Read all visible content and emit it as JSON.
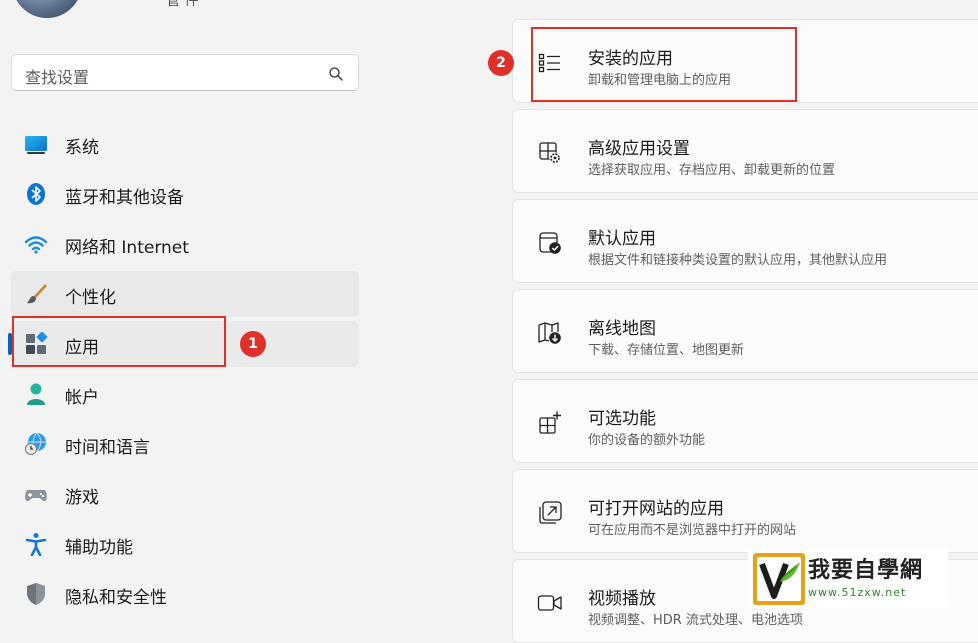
{
  "user": {
    "name_stub": "管 件"
  },
  "search": {
    "placeholder": "查找设置",
    "icon": "search-icon"
  },
  "sidebar": {
    "items": [
      {
        "label": "系统",
        "icon": "monitor-icon"
      },
      {
        "label": "蓝牙和其他设备",
        "icon": "bluetooth-icon"
      },
      {
        "label": "网络和 Internet",
        "icon": "wifi-icon"
      },
      {
        "label": "个性化",
        "icon": "paintbrush-icon"
      },
      {
        "label": "应用",
        "icon": "apps-icon"
      },
      {
        "label": "帐户",
        "icon": "person-icon"
      },
      {
        "label": "时间和语言",
        "icon": "globe-clock-icon"
      },
      {
        "label": "游戏",
        "icon": "gamepad-icon"
      },
      {
        "label": "辅助功能",
        "icon": "accessibility-icon"
      },
      {
        "label": "隐私和安全性",
        "icon": "shield-icon"
      }
    ],
    "active_index": 4
  },
  "annotations": {
    "badge_1": "1",
    "badge_2": "2",
    "marker_color": "#e0302b"
  },
  "main": {
    "cards": [
      {
        "title": "安装的应用",
        "subtitle": "卸载和管理电脑上的应用",
        "icon": "list-icon"
      },
      {
        "title": "高级应用设置",
        "subtitle": "选择获取应用、存档应用、卸载更新的位置",
        "icon": "app-gear-icon"
      },
      {
        "title": "默认应用",
        "subtitle": "根据文件和链接种类设置的默认应用，其他默认应用",
        "icon": "default-app-icon"
      },
      {
        "title": "离线地图",
        "subtitle": "下载、存储位置、地图更新",
        "icon": "offline-map-icon"
      },
      {
        "title": "可选功能",
        "subtitle": "你的设备的额外功能",
        "icon": "add-feature-icon"
      },
      {
        "title": "可打开网站的应用",
        "subtitle": "可在应用而不是浏览器中打开的网站",
        "icon": "open-link-icon"
      },
      {
        "title": "视频播放",
        "subtitle": "视频调整、HDR 流式处理、电池选项",
        "icon": "video-icon"
      }
    ]
  },
  "watermark": {
    "text": "我要自學網",
    "url": "www.51zxw.net"
  },
  "colors": {
    "accent": "#0067c0",
    "annotation_red": "#e0302b",
    "background": "#f3f3f3",
    "card": "#fbfbfb"
  }
}
